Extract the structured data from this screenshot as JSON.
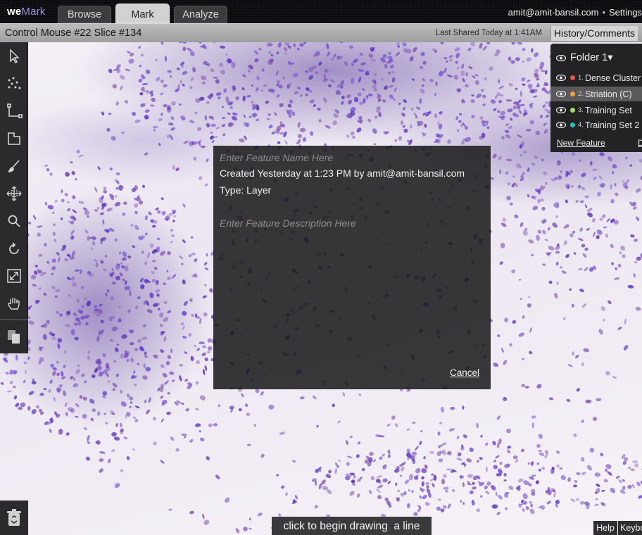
{
  "app": {
    "logo_we": "we",
    "logo_mark": "Mark"
  },
  "tabs": [
    {
      "label": "Browse",
      "active": false
    },
    {
      "label": "Mark",
      "active": true
    },
    {
      "label": "Analyze",
      "active": false
    }
  ],
  "account": {
    "email": "amit@amit-bansil.com",
    "separator": "•",
    "settings": "Settings"
  },
  "titlebar": {
    "title": "Control Mouse #22 Slice #134",
    "last_shared": "Last Shared Today at 1:41AM",
    "history": "History/Comments"
  },
  "toolbar": {
    "tools": [
      {
        "icon": "select-arrow-icon"
      },
      {
        "icon": "points-icon"
      },
      {
        "icon": "line-icon"
      },
      {
        "icon": "polygon-icon"
      },
      {
        "icon": "brush-icon"
      },
      {
        "icon": "move-icon"
      },
      {
        "icon": "zoom-icon"
      },
      {
        "icon": "rotate-icon"
      },
      {
        "icon": "fit-screen-icon"
      },
      {
        "icon": "hand-pan-icon"
      },
      {
        "icon": "copy-pages-icon"
      }
    ],
    "trash_icon": "trash-icon"
  },
  "features_panel": {
    "folder": "Folder 1",
    "folder_caret": "▾",
    "items": [
      {
        "num": "1.",
        "label": "Dense Cluster",
        "color": "#e0564f",
        "selected": false
      },
      {
        "num": "2.",
        "label": "Striation (C)",
        "color": "#f0a040",
        "selected": true
      },
      {
        "num": "3.",
        "label": "Training Set",
        "color": "#a6d86a",
        "selected": false
      },
      {
        "num": "4.",
        "label": "Training Set 2",
        "color": "#2bbfc0",
        "selected": false
      }
    ],
    "new_feature": "New Feature",
    "extra": "D"
  },
  "dialog": {
    "name_placeholder": "Enter Feature Name Here",
    "name_value": "",
    "created": "Created Yesterday at 1:23 PM by amit@amit-bansil.com",
    "type": "Type: Layer",
    "description_placeholder": "Enter Feature Description Here",
    "description_value": "",
    "cancel": "Cancel"
  },
  "footer": {
    "hint": "click to begin drawing  a line",
    "help": "Help",
    "keyboard": "Keyboard"
  },
  "colors": {
    "accent": "#9a8fe0",
    "stain": "#6a4fb0",
    "panel": "#232325"
  }
}
